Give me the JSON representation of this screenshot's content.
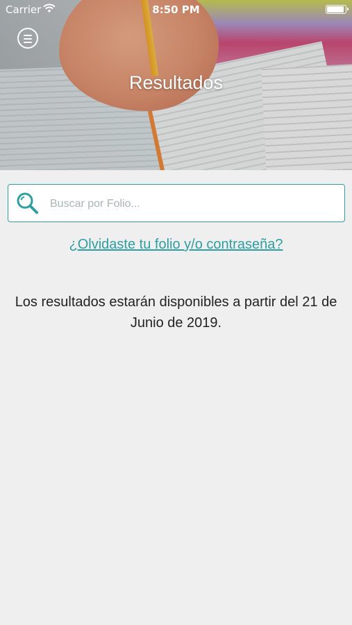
{
  "status_bar": {
    "carrier": "Carrier",
    "time": "8:50 PM"
  },
  "header": {
    "title": "Resultados"
  },
  "search": {
    "placeholder": "Buscar por Folio..."
  },
  "links": {
    "forgot": "¿Olvidaste tu folio y/o contraseña?"
  },
  "message": {
    "text": "Los resultados estarán disponibles a partir del 21 de Junio de 2019."
  },
  "theme": {
    "accent": "#2e9ea2",
    "background": "#efefef"
  },
  "icons": {
    "menu": "hamburger-circle",
    "search": "magnifier",
    "wifi": "wifi",
    "battery": "battery-full"
  }
}
